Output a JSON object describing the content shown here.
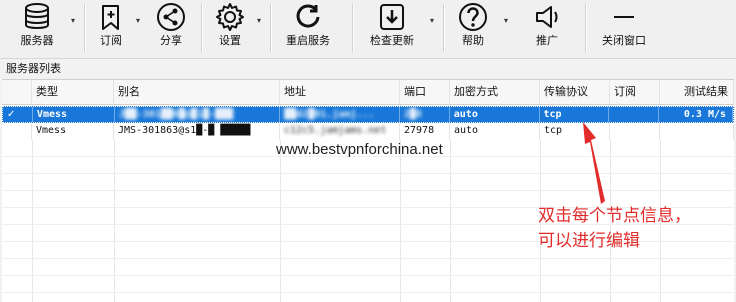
{
  "toolbar": {
    "items": [
      {
        "label": "服务器",
        "icon": "database-icon",
        "dropdown": true
      },
      {
        "label": "订阅",
        "icon": "subscribe-icon",
        "dropdown": true
      },
      {
        "label": "分享",
        "icon": "share-icon",
        "dropdown": false
      },
      {
        "label": "设置",
        "icon": "gear-icon",
        "dropdown": true
      },
      {
        "label": "重启服务",
        "icon": "restart-icon",
        "dropdown": false
      },
      {
        "label": "检查更新",
        "icon": "download-icon",
        "dropdown": true
      },
      {
        "label": "帮助",
        "icon": "help-icon",
        "dropdown": true
      },
      {
        "label": "推广",
        "icon": "speaker-icon",
        "dropdown": false
      },
      {
        "label": "关闭窗口",
        "icon": "minimize-icon",
        "dropdown": false
      }
    ]
  },
  "server_list": {
    "title": "服务器列表",
    "columns": [
      "类型",
      "别名",
      "地址",
      "端口",
      "加密方式",
      "传输协议",
      "订阅",
      "测试结果"
    ],
    "rows": [
      {
        "selected": true,
        "check": "✓",
        "type": "Vmess",
        "alias": "J██-301██6█@█1█-███",
        "address": "██d2█01.jamj...",
        "port": "2█8",
        "security": "auto",
        "network": "tcp",
        "subscription": "",
        "test_result": "0.3 M/s"
      },
      {
        "selected": false,
        "check": "",
        "type": "Vmess",
        "alias": "JMS-301863@s1█-█ █████",
        "address": "c12c5.jamjams.net",
        "port": "27978",
        "security": "auto",
        "network": "tcp",
        "subscription": "",
        "test_result": ""
      }
    ]
  },
  "watermark": "www.bestvpnforchina.net",
  "annotation": {
    "line1": "双击每个节点信息，",
    "line2": "可以进行编辑"
  },
  "colors": {
    "accent": "#1877d8",
    "annotation": "#e22b2b"
  }
}
